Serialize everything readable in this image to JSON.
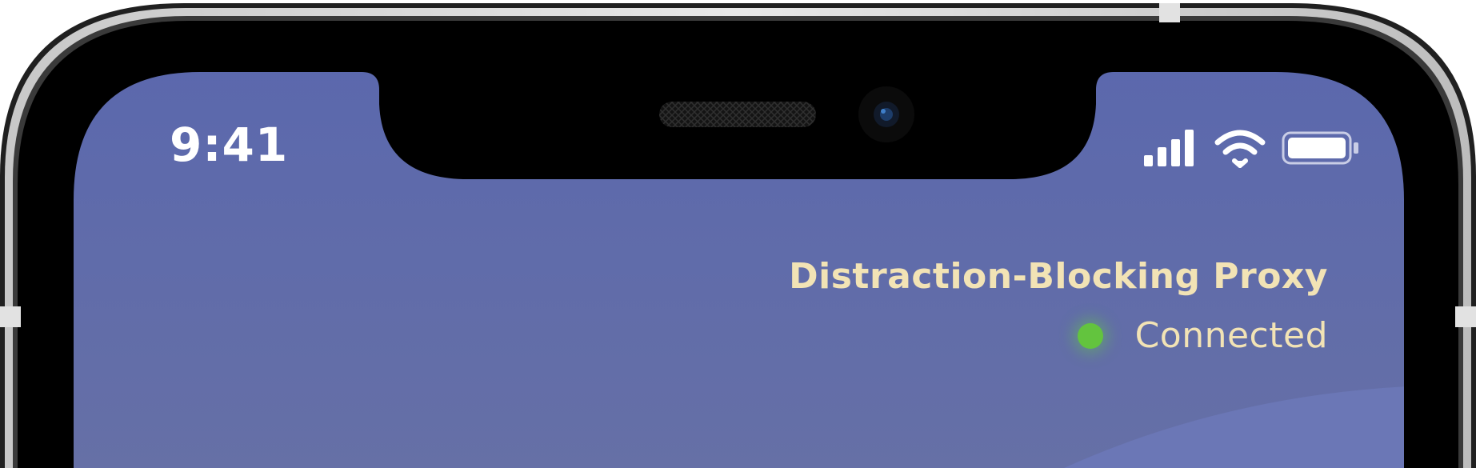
{
  "status_bar": {
    "time": "9:41",
    "icons": [
      "cellular-signal-icon",
      "wifi-icon",
      "battery-icon"
    ]
  },
  "vpn_widget": {
    "title": "Distraction-Blocking Proxy",
    "status": "Connected",
    "status_color": "#63c43e"
  },
  "colors": {
    "screen": "#5e6aa9",
    "text_accent": "#f2e3b5",
    "bezel": "#000000"
  }
}
